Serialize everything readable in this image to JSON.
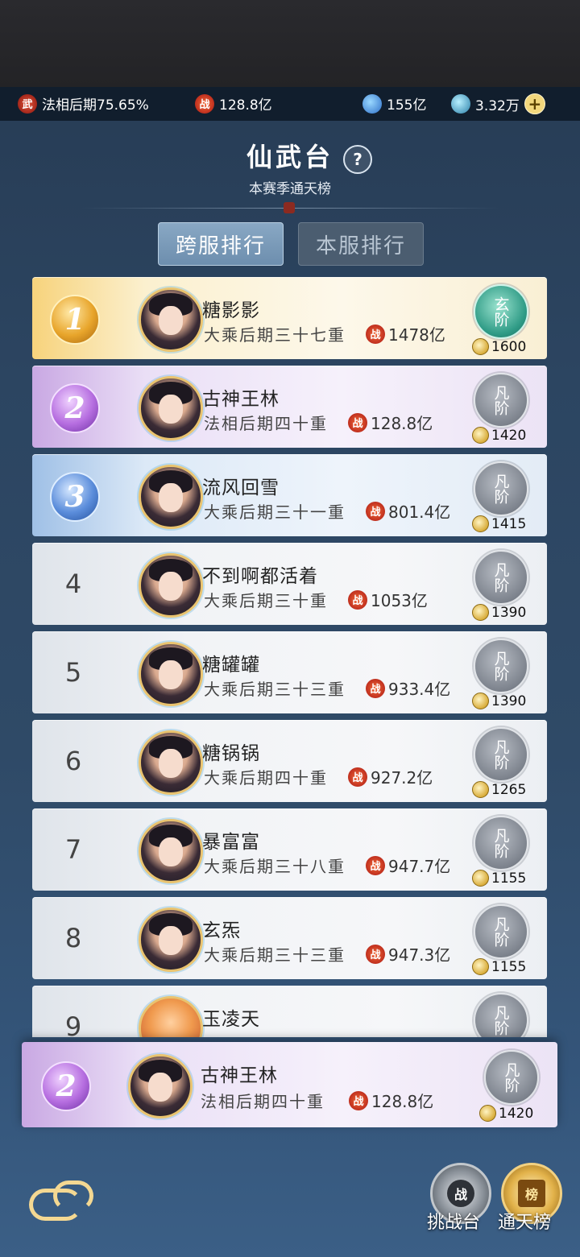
{
  "resources": {
    "realm_progress": "法相后期75.65%",
    "combat_power": "128.8亿",
    "spirit_stones": "155亿",
    "currency": "3.32万"
  },
  "header": {
    "title": "仙武台",
    "help": "?",
    "subtitle": "本赛季通天榜"
  },
  "tabs": [
    {
      "label": "跨服排行",
      "active": true
    },
    {
      "label": "本服排行",
      "active": false
    }
  ],
  "ranking": [
    {
      "rank": "1",
      "name": "糖影影",
      "realm": "大乘后期三十七重",
      "power": "1478亿",
      "tier": "玄阶",
      "score": "1600"
    },
    {
      "rank": "2",
      "name": "古神王林",
      "realm": "法相后期四十重",
      "power": "128.8亿",
      "tier": "凡阶",
      "score": "1420"
    },
    {
      "rank": "3",
      "name": "流风回雪",
      "realm": "大乘后期三十一重",
      "power": "801.4亿",
      "tier": "凡阶",
      "score": "1415"
    },
    {
      "rank": "4",
      "name": "不到啊都活着",
      "realm": "大乘后期三十重",
      "power": "1053亿",
      "tier": "凡阶",
      "score": "1390"
    },
    {
      "rank": "5",
      "name": "糖罐罐",
      "realm": "大乘后期三十三重",
      "power": "933.4亿",
      "tier": "凡阶",
      "score": "1390"
    },
    {
      "rank": "6",
      "name": "糖锅锅",
      "realm": "大乘后期四十重",
      "power": "927.2亿",
      "tier": "凡阶",
      "score": "1265"
    },
    {
      "rank": "7",
      "name": "暴富富",
      "realm": "大乘后期三十八重",
      "power": "947.7亿",
      "tier": "凡阶",
      "score": "1155"
    },
    {
      "rank": "8",
      "name": "玄炁",
      "realm": "大乘后期三十三重",
      "power": "947.3亿",
      "tier": "凡阶",
      "score": "1155"
    },
    {
      "rank": "9",
      "name": "玉凌天",
      "tier": "凡阶"
    }
  ],
  "my_rank": {
    "rank": "2",
    "name": "古神王林",
    "realm": "法相后期四十重",
    "power": "128.8亿",
    "tier": "凡阶",
    "score": "1420"
  },
  "icons": {
    "power_glyph": "战",
    "realm_glyph": "武"
  },
  "bottom_nav": [
    {
      "label": "挑战台",
      "glyph": "战"
    },
    {
      "label": "通天榜",
      "glyph": "榜"
    }
  ]
}
